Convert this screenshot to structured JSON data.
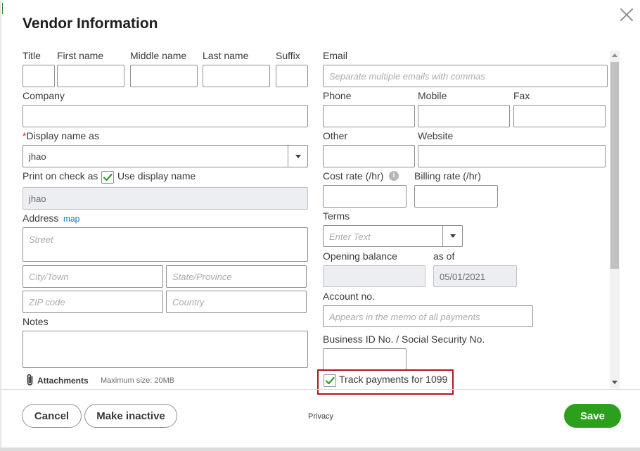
{
  "dialog": {
    "title": "Vendor Information",
    "close_icon": "close-icon"
  },
  "name": {
    "title_label": "Title",
    "first_label": "First name",
    "middle_label": "Middle name",
    "last_label": "Last name",
    "suffix_label": "Suffix"
  },
  "company": {
    "label": "Company"
  },
  "display_name": {
    "required_mark": "*",
    "label": "Display name as",
    "value": "jhao"
  },
  "print_on_check": {
    "label": "Print on check as",
    "use_display_label": "Use display name",
    "checked": true,
    "value": "jhao"
  },
  "address": {
    "label": "Address",
    "map_link": "map",
    "street_placeholder": "Street",
    "city_placeholder": "City/Town",
    "state_placeholder": "State/Province",
    "zip_placeholder": "ZIP code",
    "country_placeholder": "Country"
  },
  "notes": {
    "label": "Notes"
  },
  "attachments": {
    "label": "Attachments",
    "max_size": "Maximum size: 20MB",
    "icon": "paperclip-icon"
  },
  "email": {
    "label": "Email",
    "placeholder": "Separate multiple emails with commas"
  },
  "phone": {
    "phone_label": "Phone",
    "mobile_label": "Mobile",
    "fax_label": "Fax",
    "other_label": "Other",
    "website_label": "Website"
  },
  "rates": {
    "cost_label": "Cost rate (/hr)",
    "billing_label": "Billing rate (/hr)",
    "info_icon": "info-icon",
    "info_glyph": "i"
  },
  "terms": {
    "label": "Terms",
    "placeholder": "Enter Text"
  },
  "opening_balance": {
    "label": "Opening balance",
    "as_of_label": "as of",
    "as_of_value": "05/01/2021"
  },
  "account": {
    "label": "Account no.",
    "placeholder": "Appears in the memo of all payments"
  },
  "business_id": {
    "label": "Business ID No. / Social Security No."
  },
  "track_1099": {
    "label": "Track payments for 1099",
    "checked": true
  },
  "footer": {
    "cancel": "Cancel",
    "make_inactive": "Make inactive",
    "privacy": "Privacy",
    "save": "Save"
  },
  "colors": {
    "save_green": "#2ca01c",
    "link_blue": "#0077c5",
    "highlight_red": "#b0161e",
    "check_green": "#2ca01c"
  }
}
